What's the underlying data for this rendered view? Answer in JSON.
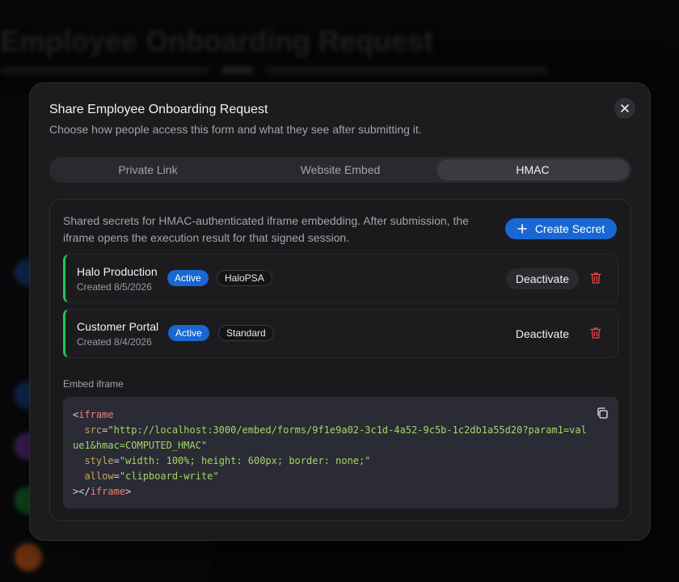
{
  "background": {
    "title": "Employee Onboarding Request"
  },
  "modal": {
    "title": "Share Employee Onboarding Request",
    "description": "Choose how people access this form and what they see after submitting it."
  },
  "tabs": [
    {
      "label": "Private Link",
      "active": false
    },
    {
      "label": "Website Embed",
      "active": false
    },
    {
      "label": "HMAC",
      "active": true
    }
  ],
  "hmac": {
    "description": "Shared secrets for HMAC-authenticated iframe embedding. After submission, the iframe opens the execution result for that signed session.",
    "create_label": "Create Secret",
    "secrets": [
      {
        "name": "Halo Production",
        "created": "Created 8/5/2026",
        "status": "Active",
        "tag": "HaloPSA",
        "action": "Deactivate"
      },
      {
        "name": "Customer Portal",
        "created": "Created 8/4/2026",
        "status": "Active",
        "tag": "Standard",
        "action": "Deactivate"
      }
    ],
    "embed_label": "Embed iframe",
    "code": {
      "open_bracket": "<",
      "tag": "iframe",
      "src_attr": "src",
      "src_value_1": "\"http://localhost:3000/embed/forms/9f1e9a02-3c1d-4a52-9c5b-1c2db1a55d20?param1=val",
      "src_value_2": "ue1&hmac=COMPUTED_HMAC\"",
      "style_attr": "style",
      "style_value": "\"width: 100%; height: 600px; border: none;\"",
      "allow_attr": "allow",
      "allow_value": "\"clipboard-write\"",
      "close_open": "></",
      "close_bracket": ">",
      "equals": "="
    }
  },
  "colors": {
    "accent": "#1967d2",
    "active_border": "#22c55e",
    "danger": "#ef4444"
  },
  "icons": {
    "close": "close-icon",
    "plus": "plus-icon",
    "trash": "trash-icon",
    "copy": "copy-icon"
  }
}
